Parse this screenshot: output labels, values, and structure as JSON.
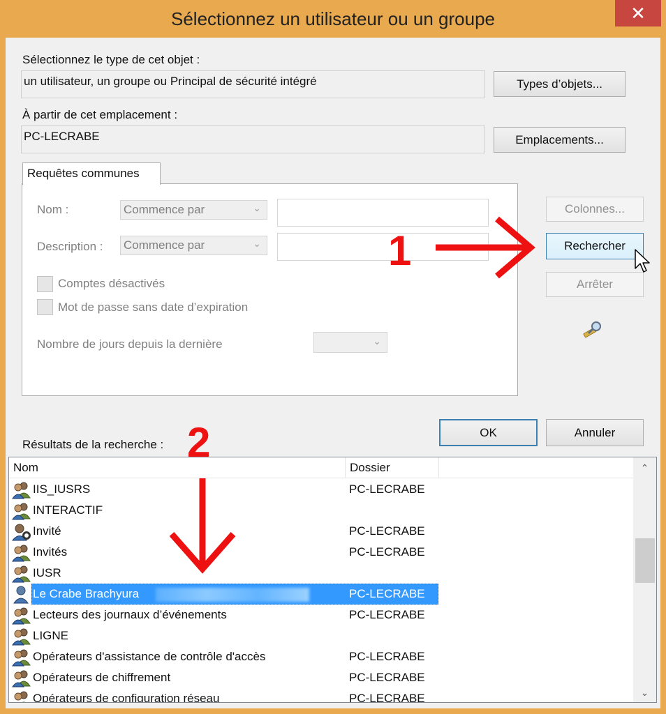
{
  "window": {
    "title": "Sélectionnez un utilisateur ou un groupe",
    "close_label": "✕"
  },
  "object_type": {
    "label": "Sélectionnez le type de cet objet :",
    "value": "un utilisateur, un groupe ou Principal de sécurité intégré",
    "button": "Types d’objets..."
  },
  "location": {
    "label": "À partir de cet emplacement :",
    "value": "PC-LECRABE",
    "button": "Emplacements..."
  },
  "common_queries": {
    "tab_label": "Requêtes communes",
    "name_label": "Nom :",
    "name_mode": "Commence par",
    "description_label": "Description :",
    "description_mode": "Commence par",
    "disabled_accounts": "Comptes désactivés",
    "no_expiry_password": "Mot de passe sans date d’expiration",
    "days_since_label": "Nombre de jours depuis la dernière"
  },
  "side_buttons": {
    "columns": "Colonnes...",
    "search": "Rechercher",
    "stop": "Arrêter"
  },
  "dialog_buttons": {
    "ok": "OK",
    "cancel": "Annuler"
  },
  "results": {
    "label": "Résultats de la recherche :",
    "columns": [
      "Nom",
      "Dossier"
    ],
    "rows": [
      {
        "name": "IIS_IUSRS",
        "folder": "PC-LECRABE",
        "icon": "group-icon"
      },
      {
        "name": "INTERACTIF",
        "folder": "",
        "icon": "group-icon"
      },
      {
        "name": "Invité",
        "folder": "PC-LECRABE",
        "icon": "guest-user-icon"
      },
      {
        "name": "Invités",
        "folder": "PC-LECRABE",
        "icon": "group-icon"
      },
      {
        "name": "IUSR",
        "folder": "",
        "icon": "group-icon"
      },
      {
        "name": "Le Crabe Brachyura",
        "folder": "PC-LECRABE",
        "icon": "user-icon",
        "selected": true
      },
      {
        "name": "Lecteurs des journaux d’événements",
        "folder": "PC-LECRABE",
        "icon": "group-icon"
      },
      {
        "name": "LIGNE",
        "folder": "",
        "icon": "group-icon"
      },
      {
        "name": "Opérateurs d'assistance de contrôle d'accès",
        "folder": "PC-LECRABE",
        "icon": "group-icon"
      },
      {
        "name": "Opérateurs de chiffrement",
        "folder": "PC-LECRABE",
        "icon": "group-icon"
      },
      {
        "name": "Opérateurs de configuration réseau",
        "folder": "PC-LECRABE",
        "icon": "group-icon"
      }
    ]
  },
  "annotations": {
    "step1": "1",
    "step2": "2",
    "color": "#ee1111"
  }
}
